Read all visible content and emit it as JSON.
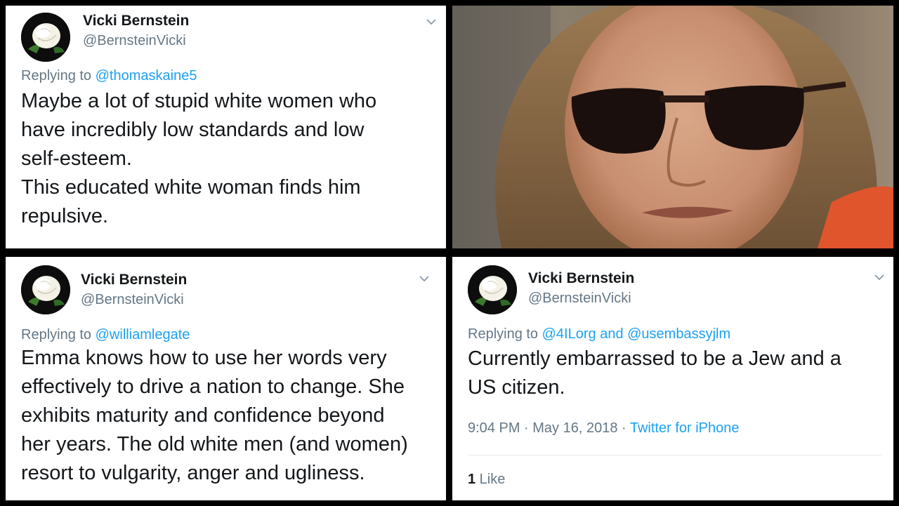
{
  "tweets": [
    {
      "display_name": "Vicki Bernstein",
      "handle": "@BernsteinVicki",
      "replying_prefix": "Replying to",
      "replying_to": "@thomaskaine5",
      "text": "Maybe a lot of stupid white women who\nhave incredibly low standards and low\nself-esteem.\nThis educated white woman finds him\nrepulsive."
    },
    {
      "display_name": "Vicki Bernstein",
      "handle": "@BernsteinVicki",
      "replying_prefix": "Replying to",
      "replying_to": "@williamlegate",
      "text": "Emma knows how to use her words very\neffectively to drive a nation to change. She\nexhibits maturity and confidence beyond\nher years. The old white men (and women)\nresort to vulgarity, anger and ugliness."
    },
    {
      "display_name": "Vicki Bernstein",
      "handle": "@BernsteinVicki",
      "replying_prefix": "Replying to",
      "replying_to": "@4ILorg and @usembassyjlm",
      "text": "Currently embarrassed to be a Jew and a\nUS citizen.",
      "time": "9:04 PM · May 16, 2018 · ",
      "source": "Twitter for iPhone",
      "like_count": "1",
      "like_label": " Like"
    }
  ],
  "icons": {
    "avatar": "white-rose-icon",
    "menu": "chevron-down-icon"
  },
  "colors": {
    "link": "#1da1f2",
    "secondary_text": "#657786",
    "primary_text": "#14171a"
  }
}
